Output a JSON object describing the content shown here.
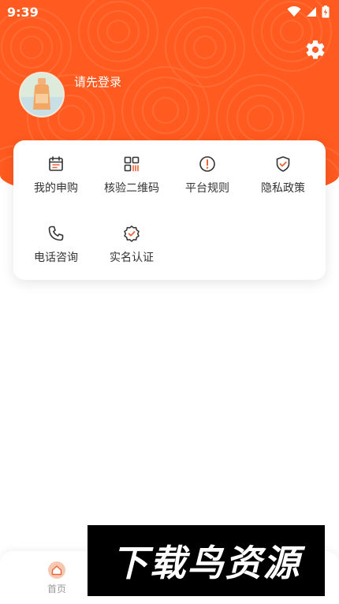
{
  "status_bar": {
    "time": "9:39"
  },
  "header": {
    "login_prompt": "请先登录"
  },
  "menu": {
    "items": [
      {
        "label": "我的申购",
        "icon": "calendar-icon"
      },
      {
        "label": "核验二维码",
        "icon": "qr-code-icon"
      },
      {
        "label": "平台规则",
        "icon": "alert-circle-icon"
      },
      {
        "label": "隐私政策",
        "icon": "shield-check-icon"
      },
      {
        "label": "电话咨询",
        "icon": "phone-icon"
      },
      {
        "label": "实名认证",
        "icon": "verified-badge-icon"
      }
    ]
  },
  "tabbar": {
    "home_label": "首页"
  },
  "watermark": {
    "text": "下载鸟资源"
  },
  "colors": {
    "brand": "#ff5a1f",
    "accent": "#e8663a"
  }
}
